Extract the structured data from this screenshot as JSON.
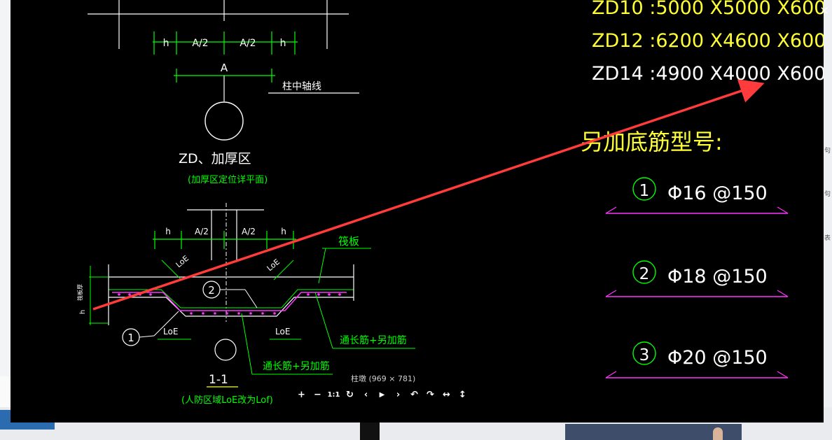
{
  "background": {
    "button_label": "",
    "side_chars": [
      "句",
      "句",
      "表"
    ]
  },
  "viewer": {
    "caption": "柱墩 (969 × 781)",
    "close_label": "×",
    "toolbar": [
      {
        "name": "zoom-in-button",
        "label": "+"
      },
      {
        "name": "zoom-out-button",
        "label": "−"
      },
      {
        "name": "actual-size-button",
        "label": "1:1"
      },
      {
        "name": "reset-button",
        "label": "↻"
      },
      {
        "name": "previous-button",
        "label": "‹"
      },
      {
        "name": "play-button",
        "label": "▶"
      },
      {
        "name": "next-button",
        "label": "›"
      },
      {
        "name": "rotate-left-button",
        "label": "↶"
      },
      {
        "name": "rotate-right-button",
        "label": "↷"
      },
      {
        "name": "flip-horizontal-button",
        "label": "↔"
      },
      {
        "name": "flip-vertical-button",
        "label": "↕"
      }
    ]
  },
  "drawing": {
    "plan": {
      "dims": [
        "h",
        "A/2",
        "A/2",
        "h"
      ],
      "total": "A",
      "axis_note": "柱中轴线",
      "title": "ZD、加厚区",
      "subtitle": "(加厚区定位详平面)"
    },
    "section": {
      "dims": [
        "h",
        "A/2",
        "A/2",
        "h"
      ],
      "loe_diag": [
        "LoE",
        "LoE"
      ],
      "loe_bottom": [
        "LoE",
        "LoE"
      ],
      "slab_label": "筏板",
      "slab_thickness": "筏板厚",
      "h_label": "h",
      "markers": [
        "1",
        "2"
      ],
      "rebar_right": "通长筋+另加筋",
      "rebar_bottom": "通长筋+另加筋",
      "title": "1-1",
      "subtitle": "(人防区域LoE改为Lof)"
    },
    "zd_specs": [
      "ZD10 :5000 X5000 X600",
      "ZD12 :6200 X4600 X600",
      "ZD14 :4900 X4000 X600"
    ],
    "extra_rebar_title": "另加底筋型号:",
    "extra_rebar": [
      {
        "num": "1",
        "spec": "Φ16 @150"
      },
      {
        "num": "2",
        "spec": "Φ18 @150"
      },
      {
        "num": "3",
        "spec": "Φ20 @150"
      }
    ]
  },
  "colors": {
    "cad_bg": "#000000",
    "green": "#00ff00",
    "white": "#ffffff",
    "yellow": "#ffff33",
    "magenta": "#ff33ff",
    "red_arrow": "#ff3b3b",
    "toolbar_icon": "#ffffff"
  }
}
